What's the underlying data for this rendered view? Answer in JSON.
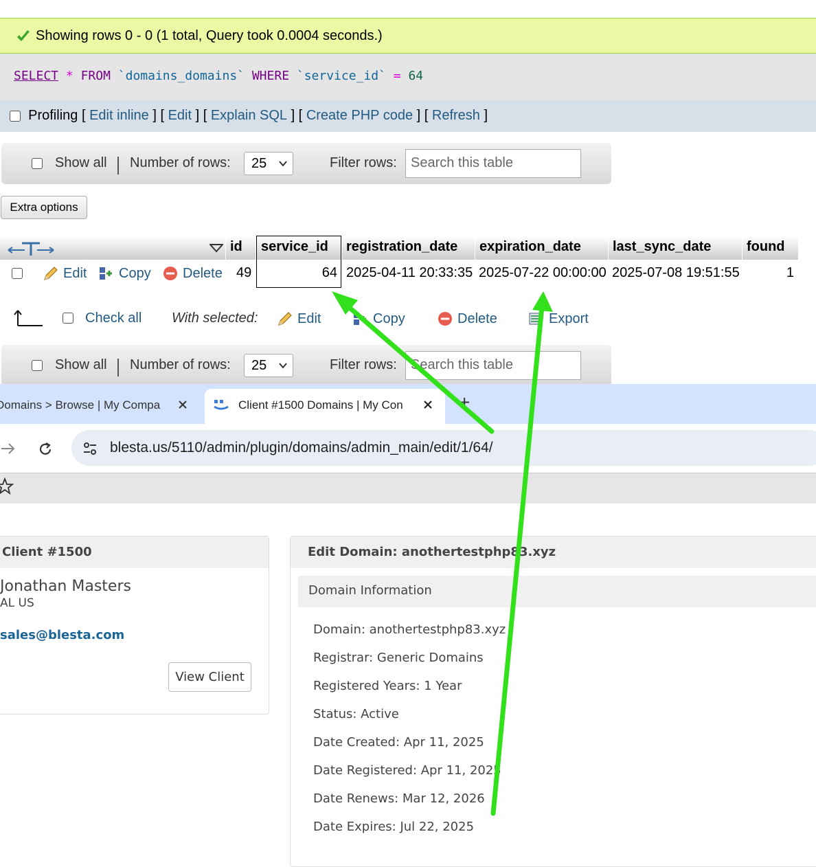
{
  "pma": {
    "success": "Showing rows 0 - 0 (1 total, Query took 0.0004 seconds.)",
    "sql": {
      "select": "SELECT",
      "star": "*",
      "from": "FROM",
      "table": "`domains_domains`",
      "where": "WHERE",
      "column": "`service_id`",
      "eq": "=",
      "value": "64"
    },
    "profiling": {
      "label": "Profiling",
      "links": [
        "Edit inline",
        "Edit",
        "Explain SQL",
        "Create PHP code",
        "Refresh"
      ]
    },
    "nav": {
      "show_all": "Show all",
      "number_of_rows": "Number of rows:",
      "rows_value": "25",
      "filter_rows": "Filter rows:",
      "search_placeholder": "Search this table"
    },
    "extra_options": "Extra options",
    "columns": [
      "id",
      "service_id",
      "registration_date",
      "expiration_date",
      "last_sync_date",
      "found"
    ],
    "row": {
      "id": "49",
      "service_id": "64",
      "registration_date": "2025-04-11 20:33:35",
      "expiration_date": "2025-07-22 00:00:00",
      "last_sync_date": "2025-07-08 19:51:55",
      "found": "1"
    },
    "row_actions": {
      "edit": "Edit",
      "copy": "Copy",
      "delete": "Delete"
    },
    "bulk": {
      "check_all": "Check all",
      "with_selected": "With selected:",
      "edit": "Edit",
      "copy": "Copy",
      "delete": "Delete",
      "export": "Export"
    }
  },
  "browser": {
    "tab1": "Domains > Browse | My Compa",
    "tab2": "Client #1500 Domains | My Con",
    "new_tab": "+",
    "url": "blesta.us/5110/admin/plugin/domains/admin_main/edit/1/64/"
  },
  "blesta": {
    "client_header": "Client #1500",
    "client_name": "Jonathan Masters",
    "client_location": "AL US",
    "client_email": "sales@blesta.com",
    "view_client": "View Client",
    "edit_header": "Edit Domain: anothertestphp83.xyz",
    "domain_info_header": "Domain Information",
    "info": [
      "Domain: anothertestphp83.xyz",
      "Registrar: Generic Domains",
      "Registered Years: 1 Year",
      "Status: Active",
      "Date Created: Apr 11, 2025",
      "Date Registered: Apr 11, 2025",
      "Date Renews: Mar 12, 2026",
      "Date Expires: Jul 22, 2025"
    ]
  },
  "colors": {
    "arrow": "#33e01c",
    "link": "#235a81",
    "success_bg": "#ebf8a4"
  }
}
